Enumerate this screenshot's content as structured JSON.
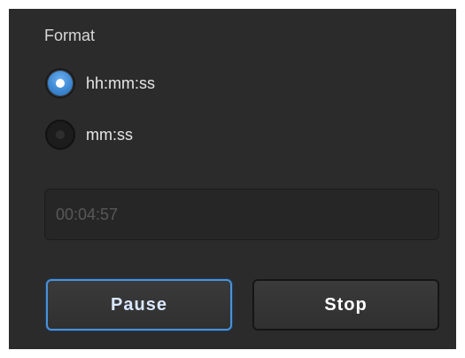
{
  "format": {
    "label": "Format",
    "options": [
      {
        "label": "hh:mm:ss",
        "selected": true
      },
      {
        "label": "mm:ss",
        "selected": false
      }
    ]
  },
  "time_field": {
    "value": "00:04:57"
  },
  "buttons": {
    "pause_label": "Pause",
    "stop_label": "Stop"
  },
  "colors": {
    "accent": "#4a92d9",
    "panel_bg": "#2b2b2b"
  }
}
